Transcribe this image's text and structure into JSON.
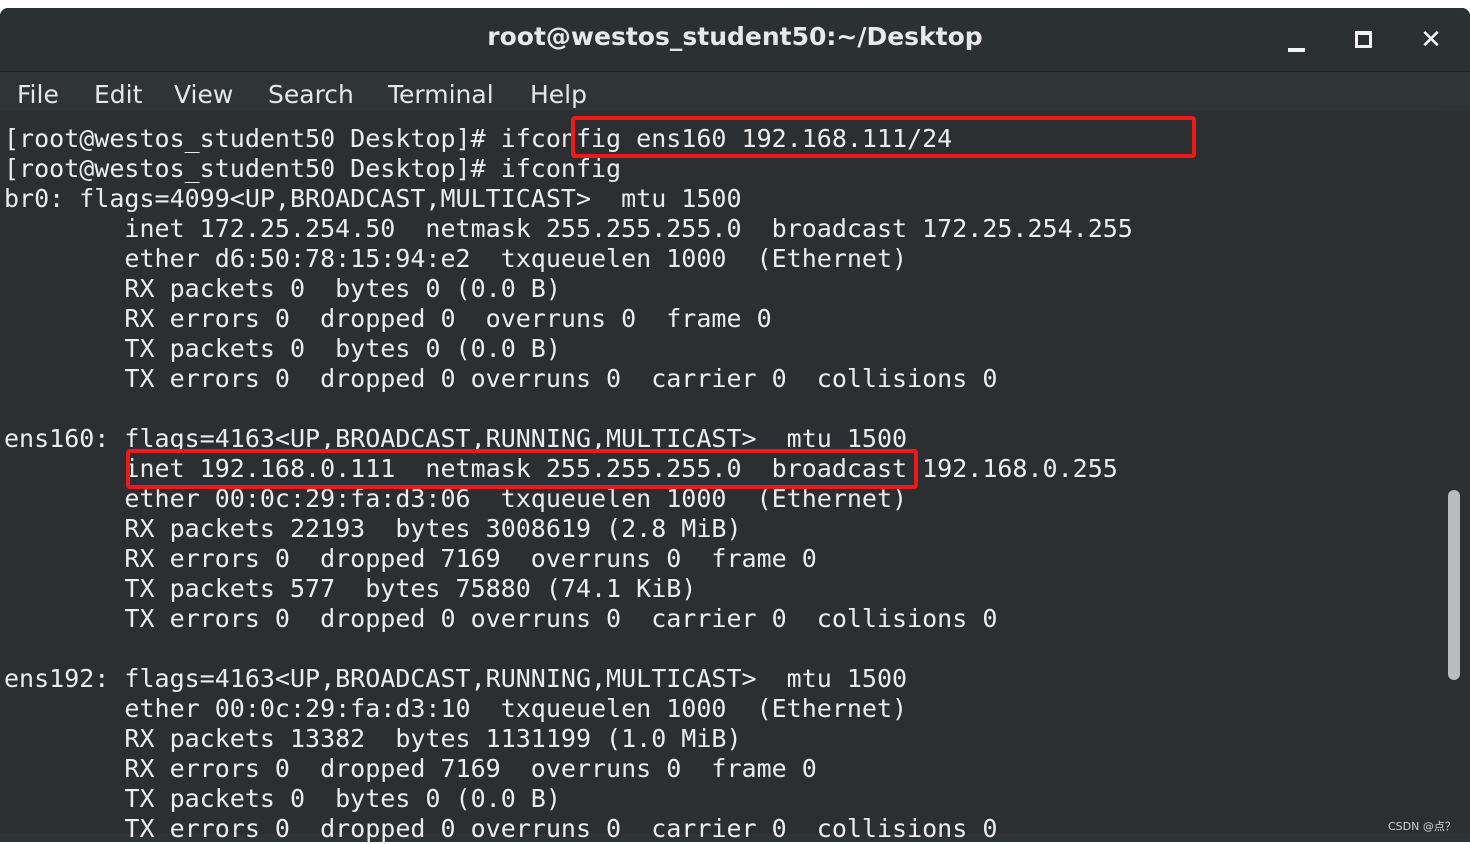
{
  "window": {
    "title": "root@westos_student50:~/Desktop",
    "controls": {
      "minimize_icon": "minimize-icon",
      "maximize_icon": "maximize-icon",
      "close_label": "✕"
    }
  },
  "menu": {
    "items": [
      "File",
      "Edit",
      "View",
      "Search",
      "Terminal",
      "Help"
    ]
  },
  "terminal": {
    "lines": [
      "[root@westos_student50 Desktop]# ifconfig ens160 192.168.111/24",
      "[root@westos_student50 Desktop]# ifconfig",
      "br0: flags=4099<UP,BROADCAST,MULTICAST>  mtu 1500",
      "        inet 172.25.254.50  netmask 255.255.255.0  broadcast 172.25.254.255",
      "        ether d6:50:78:15:94:e2  txqueuelen 1000  (Ethernet)",
      "        RX packets 0  bytes 0 (0.0 B)",
      "        RX errors 0  dropped 0  overruns 0  frame 0",
      "        TX packets 0  bytes 0 (0.0 B)",
      "        TX errors 0  dropped 0 overruns 0  carrier 0  collisions 0",
      "",
      "ens160: flags=4163<UP,BROADCAST,RUNNING,MULTICAST>  mtu 1500",
      "        inet 192.168.0.111  netmask 255.255.255.0  broadcast 192.168.0.255",
      "        ether 00:0c:29:fa:d3:06  txqueuelen 1000  (Ethernet)",
      "        RX packets 22193  bytes 3008619 (2.8 MiB)",
      "        RX errors 0  dropped 7169  overruns 0  frame 0",
      "        TX packets 577  bytes 75880 (74.1 KiB)",
      "        TX errors 0  dropped 0 overruns 0  carrier 0  collisions 0",
      "",
      "ens192: flags=4163<UP,BROADCAST,RUNNING,MULTICAST>  mtu 1500",
      "        ether 00:0c:29:fa:d3:10  txqueuelen 1000  (Ethernet)",
      "        RX packets 13382  bytes 1131199 (1.0 MiB)",
      "        RX errors 0  dropped 7169  overruns 0  frame 0",
      "        TX packets 0  bytes 0 (0.0 B)",
      "        TX errors 0  dropped 0 overruns 0  carrier 0  collisions 0"
    ]
  },
  "colors": {
    "highlight": "#ee1a1a",
    "terminal_bg": "#2b2f31",
    "terminal_fg": "#ededed"
  },
  "watermark": "CSDN @点？"
}
